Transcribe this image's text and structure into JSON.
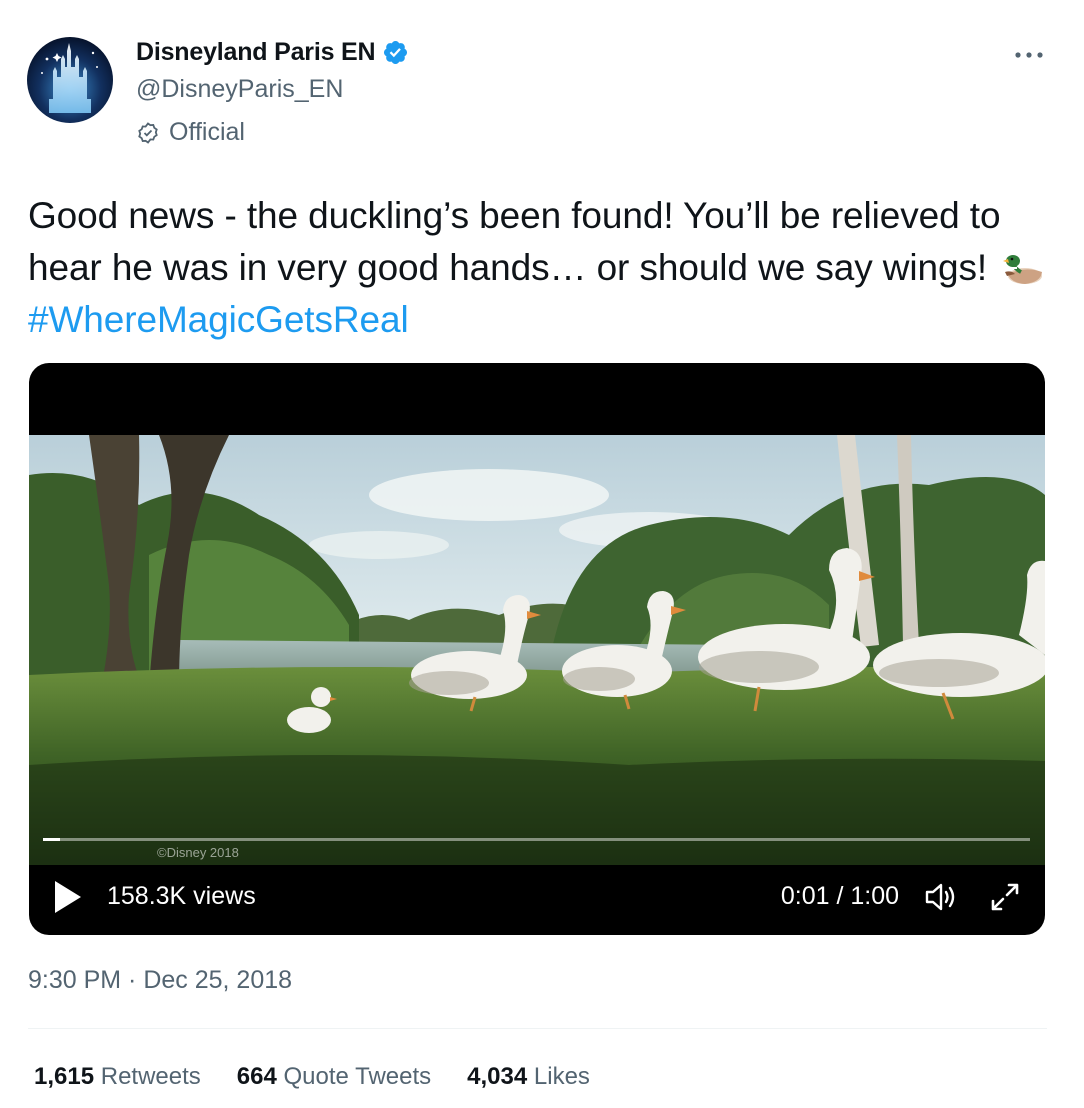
{
  "author": {
    "display_name": "Disneyland Paris EN",
    "handle": "@DisneyParis_EN",
    "official_label": "Official"
  },
  "tweet": {
    "text_before_emoji": "Good news - the duckling’s been found! You’ll be relieved to hear he was in very good hands… or should we say wings! ",
    "emoji": "duck-emoji",
    "hashtag": "#WhereMagicGetsReal"
  },
  "video": {
    "copyright": "©Disney 2018",
    "views": "158.3K views",
    "time": "0:01 / 1:00",
    "progress": 0.017
  },
  "timestamp": "9:30 PM · Dec 25, 2018",
  "stats": [
    {
      "count": "1,615",
      "label": "Retweets"
    },
    {
      "count": "664",
      "label": "Quote Tweets"
    },
    {
      "count": "4,034",
      "label": "Likes"
    }
  ],
  "colors": {
    "link": "#1d9bf0",
    "secondary_text": "#536471",
    "verified": "#1d9bf0"
  }
}
